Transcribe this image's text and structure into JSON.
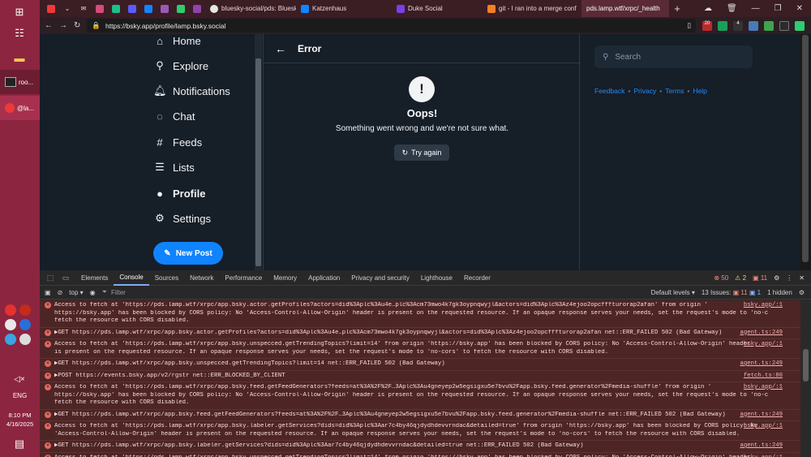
{
  "taskbar": {
    "apps": [
      "roo...",
      "@la..."
    ],
    "clock": {
      "time": "8:10 PM",
      "date": "4/16/2025"
    },
    "lang": "ENG"
  },
  "browser": {
    "tabs": [
      {
        "label": "bluesky-social/pds: Bluesky",
        "color": "#e6e6e6"
      },
      {
        "label": "Katzenhaus",
        "color": "#1185fe"
      },
      {
        "label": "Duke Social",
        "color": "#7b3fe4"
      },
      {
        "label": "git - I ran into a merge conf",
        "color": "#f48024"
      },
      {
        "label": "pds.lamp.wtf/xrpc/_health",
        "color": "#888888"
      }
    ],
    "url": "https://bsky.app/profile/lamp.bsky.social",
    "ext_badges": [
      "20",
      "4"
    ]
  },
  "bluesky": {
    "nav": [
      {
        "label": "Home",
        "icon": "home-icon"
      },
      {
        "label": "Explore",
        "icon": "search-icon"
      },
      {
        "label": "Notifications",
        "icon": "bell-icon"
      },
      {
        "label": "Chat",
        "icon": "chat-icon"
      },
      {
        "label": "Feeds",
        "icon": "hash-icon"
      },
      {
        "label": "Lists",
        "icon": "list-icon"
      },
      {
        "label": "Profile",
        "icon": "user-icon"
      },
      {
        "label": "Settings",
        "icon": "gear-icon"
      }
    ],
    "new_post": "New Post",
    "header_title": "Error",
    "error": {
      "icon": "!",
      "title": "Oops!",
      "message": "Something went wrong and we're not sure what.",
      "retry": "Try again"
    },
    "search_placeholder": "Search",
    "links": [
      "Feedback",
      "Privacy",
      "Terms",
      "Help"
    ],
    "accent": "#1083fe"
  },
  "devtools": {
    "tabs": [
      "Elements",
      "Console",
      "Sources",
      "Network",
      "Performance",
      "Memory",
      "Application",
      "Privacy and security",
      "Lighthouse",
      "Recorder"
    ],
    "active_tab": "Console",
    "error_count": "50",
    "warning_count": "2",
    "issue_count_badge": "11",
    "context": "top",
    "filter_placeholder": "Filter",
    "levels": "Default levels",
    "issues": "13 Issues:",
    "issues_errors": "11",
    "issues_info": "1",
    "hidden": "1 hidden",
    "logs": [
      {
        "l1": "Access to fetch at 'https://pds.lamp.wtf/xrpc/app.bsky.actor.getProfiles?actors=did%3Aplc%3Au4e…plc%3Acm73mwo4k7gk3oypnqwyjl&actors=did%3Aplc%3Az4ejoo2opcfffturorap2afan' from origin '",
        "l2": "https://bsky.app' has been blocked by CORS policy: No 'Access-Control-Allow-Origin' header is present on the requested resource. If an opaque response serves your needs, set the request's mode to 'no-cors' to",
        "l3": "fetch the resource with CORS disabled.",
        "src": "bsky.app/:1"
      },
      {
        "l1": "▶GET https://pds.lamp.wtf/xrpc/app.bsky.actor.getProfiles?actors=did%3Aplc%3Au4e…plc%3Acm73mwo4k7gk3oypnqwyjl&actors=did%3Aplc%3Az4ejoo2opcfffturorap2afan net::ERR_FAILED 502 (Bad Gateway)",
        "l2": "",
        "l3": "",
        "src": "agent.ts:249"
      },
      {
        "l1": "Access to fetch at 'https://pds.lamp.wtf/xrpc/app.bsky.unspecced.getTrendingTopics?limit=14' from origin 'https://bsky.app' has been blocked by CORS policy: No 'Access-Control-Allow-Origin' header",
        "l2": "is present on the requested resource. If an opaque response serves your needs, set the request's mode to 'no-cors' to fetch the resource with CORS disabled.",
        "l3": "",
        "src": "bsky.app/:1"
      },
      {
        "l1": "▶GET https://pds.lamp.wtf/xrpc/app.bsky.unspecced.getTrendingTopics?limit=14 net::ERR_FAILED 502 (Bad Gateway)",
        "l2": "",
        "l3": "",
        "src": "agent.ts:249"
      },
      {
        "l1": "▶POST https://events.bsky.app/v2/rgstr net::ERR_BLOCKED_BY_CLIENT",
        "l2": "",
        "l3": "",
        "src": "fetch.ts:80"
      },
      {
        "l1": "Access to fetch at 'https://pds.lamp.wtf/xrpc/app.bsky.feed.getFeedGenerators?feeds=at%3A%2F%2F…3Aplc%3Au4gneyep2w5egsigxu5e7bvu%2Fapp.bsky.feed.generator%2Fmedia-shuffle' from origin '",
        "l2": "https://bsky.app' has been blocked by CORS policy: No 'Access-Control-Allow-Origin' header is present on the requested resource. If an opaque response serves your needs, set the request's mode to 'no-cors' to",
        "l3": "fetch the resource with CORS disabled.",
        "src": "bsky.app/:1"
      },
      {
        "l1": "▶GET https://pds.lamp.wtf/xrpc/app.bsky.feed.getFeedGenerators?feeds=at%3A%2F%2F…3Aplc%3Au4gneyep2w5egsigxu5e7bvu%2Fapp.bsky.feed.generator%2Fmedia-shuffle net::ERR_FAILED 502 (Bad Gateway)",
        "l2": "",
        "l3": "",
        "src": "agent.ts:249"
      },
      {
        "l1": "Access to fetch at 'https://pds.lamp.wtf/xrpc/app.bsky.labeler.getServices?dids=did%3Aplc%3Aar7c4by46qjdydhdevvrndac&detailed=true' from origin 'https://bsky.app' has been blocked by CORS policy: No",
        "l2": "'Access-Control-Allow-Origin' header is present on the requested resource. If an opaque response serves your needs, set the request's mode to 'no-cors' to fetch the resource with CORS disabled.",
        "l3": "",
        "src": "bsky.app/:1"
      },
      {
        "l1": "▶GET https://pds.lamp.wtf/xrpc/app.bsky.labeler.getServices?dids=did%3Aplc%3Aar7c4by46qjdydhdevvrndac&detailed=true net::ERR_FAILED 502 (Bad Gateway)",
        "l2": "",
        "l3": "",
        "src": "agent.ts:249"
      },
      {
        "l1": "Access to fetch at 'https://pds.lamp.wtf/xrpc/app.bsky.unspecced.getTrendingTopics?limit=14' from origin 'https://bsky.app' has been blocked by CORS policy: No 'Access-Control-Allow-Origin' header",
        "l2": "",
        "l3": "",
        "src": "bsky.app/:1"
      }
    ]
  }
}
